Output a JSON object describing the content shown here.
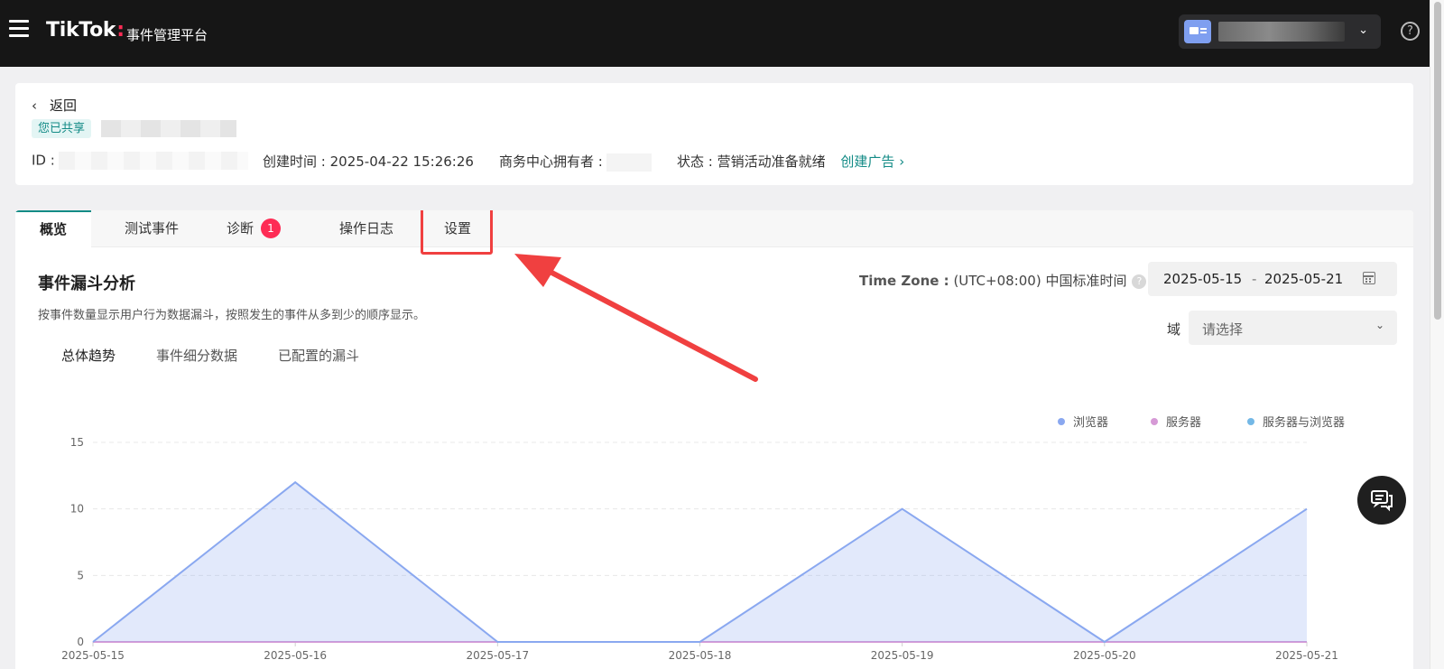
{
  "header": {
    "logo_main": "TikTok",
    "logo_colon": ":",
    "logo_sub": "事件管理平台",
    "help_glyph": "?"
  },
  "info": {
    "back_label": "返回",
    "shared_badge": "您已共享",
    "id_label": "ID :",
    "created_label": "创建时间 :",
    "created_value": "2025-04-22 15:26:26",
    "owner_label": "商务中心拥有者 :",
    "status_label": "状态 :",
    "status_value": "营销活动准备就绪",
    "create_ad_label": "创建广告",
    "create_ad_chevron": "›"
  },
  "tabs": [
    {
      "label": "概览",
      "active": true
    },
    {
      "label": "测试事件",
      "active": false
    },
    {
      "label": "诊断",
      "active": false,
      "badge": "1"
    },
    {
      "label": "操作日志",
      "active": false
    },
    {
      "label": "设置",
      "active": false,
      "highlighted": true
    }
  ],
  "section": {
    "title": "事件漏斗分析",
    "description": "按事件数量显示用户行为数据漏斗，按照发生的事件从多到少的顺序显示。",
    "timezone_label": "Time Zone :",
    "timezone_value": "(UTC+08:00) 中国标准时间",
    "date_start": "2025-05-15",
    "date_separator": "-",
    "date_end": "2025-05-21",
    "domain_label": "域",
    "domain_placeholder": "请选择"
  },
  "subtabs": [
    {
      "label": "总体趋势",
      "active": true
    },
    {
      "label": "事件细分数据",
      "active": false
    },
    {
      "label": "已配置的漏斗",
      "active": false
    }
  ],
  "colors": {
    "accent": "#138b86",
    "browser": "#8aa8f0",
    "server": "#d69ad6",
    "server_browser": "#74b8e6",
    "annotation": "#f04040"
  },
  "chart_data": {
    "type": "area",
    "x": [
      "2025-05-15",
      "2025-05-16",
      "2025-05-17",
      "2025-05-18",
      "2025-05-19",
      "2025-05-20",
      "2025-05-21"
    ],
    "ylim": [
      0,
      15
    ],
    "yticks": [
      0,
      5,
      10,
      15
    ],
    "grid": true,
    "legend_position": "top-right",
    "series": [
      {
        "name": "浏览器",
        "values": [
          0,
          12,
          0,
          0,
          10,
          0,
          10
        ]
      },
      {
        "name": "服务器",
        "values": [
          0,
          0,
          0,
          0,
          0,
          0,
          0
        ]
      },
      {
        "name": "服务器与浏览器",
        "values": [
          0,
          0,
          0,
          0,
          0,
          0,
          0
        ]
      }
    ]
  }
}
